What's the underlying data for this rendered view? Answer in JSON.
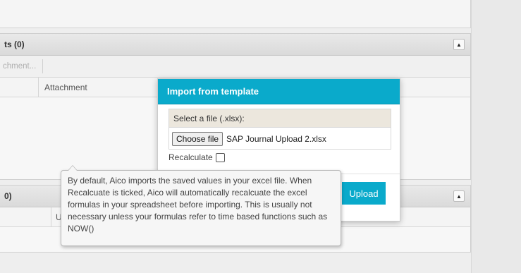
{
  "background_panel": {
    "attachments_title": "ts (0)",
    "toolbar_item": "chment...",
    "column_attachment": "Attachment",
    "second_panel_title": "0)",
    "second_panel_column": "Use"
  },
  "modal": {
    "title": "Import from template",
    "file_label": "Select a file (.xlsx):",
    "choose_button": "Choose file",
    "selected_file": "SAP Journal Upload 2.xlsx",
    "recalculate_label": "Recalculate",
    "recalculate_checked": false,
    "upload_button": "Upload"
  },
  "tooltip": {
    "text": "By default, Aico imports the saved values in your excel file. When Recalcuate is ticked, Aico will automatically recalcuate the excel formulas in your spreadsheet before importing. This is usually not necessary unless your formulas refer to time based functions such as NOW()"
  },
  "icons": {
    "collapse": "collapse-up-icon"
  },
  "colors": {
    "accent": "#0aaacb",
    "file_label_bg": "#ece7dd",
    "tooltip_bg": "#f6f6f6"
  }
}
